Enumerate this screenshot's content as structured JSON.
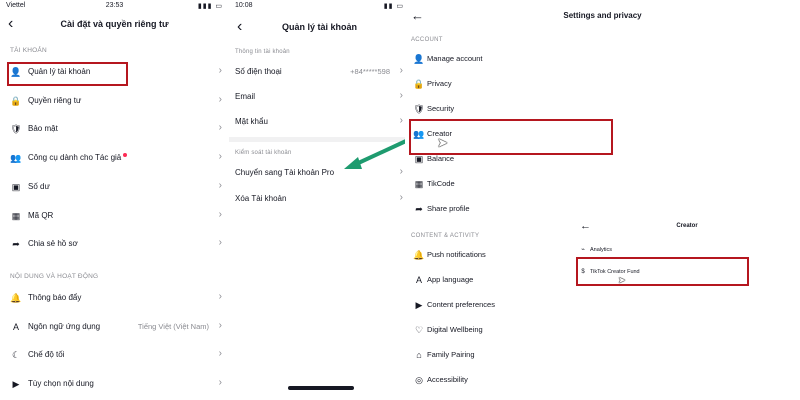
{
  "panel1": {
    "status": {
      "carrier": "Viettel",
      "time": "23:53"
    },
    "title": "Cài đặt và quyền riêng tư",
    "section_account": "TÀI KHOẢN",
    "account_items": [
      {
        "label": "Quản lý tài khoản",
        "icon": "person-icon",
        "glyph": "👤"
      },
      {
        "label": "Quyền riêng tư",
        "icon": "lock-icon",
        "glyph": "🔒"
      },
      {
        "label": "Bảo mật",
        "icon": "shield-icon",
        "glyph": "🛡"
      },
      {
        "label": "Công cụ dành cho Tác giả",
        "icon": "creator-icon",
        "glyph": "👥",
        "badge": true
      },
      {
        "label": "Số dư",
        "icon": "wallet-icon",
        "glyph": "▣"
      },
      {
        "label": "Mã QR",
        "icon": "qr-icon",
        "glyph": "▦"
      },
      {
        "label": "Chia sẻ hồ sơ",
        "icon": "share-icon",
        "glyph": "➦"
      }
    ],
    "section_content": "NỘI DUNG VÀ HOẠT ĐỘNG",
    "content_items": [
      {
        "label": "Thông báo đẩy",
        "icon": "bell-icon",
        "glyph": "🔔"
      },
      {
        "label": "Ngôn ngữ ứng dụng",
        "icon": "language-icon",
        "glyph": "A",
        "value": "Tiếng Việt (Việt Nam)"
      },
      {
        "label": "Chế độ tối",
        "icon": "moon-icon",
        "glyph": "☾"
      },
      {
        "label": "Tùy chọn nội dung",
        "icon": "video-icon",
        "glyph": "▶"
      }
    ]
  },
  "panel2": {
    "status": {
      "time": "10:08"
    },
    "title": "Quản lý tài khoản",
    "section_info": "Thông tin tài khoản",
    "info_items": [
      {
        "label": "Số điện thoại",
        "value": "+84*****598"
      },
      {
        "label": "Email",
        "value": ""
      },
      {
        "label": "Mật khẩu",
        "value": ""
      }
    ],
    "section_control": "Kiểm soát tài khoản",
    "control_items": [
      {
        "label": "Chuyển sang Tài khoản Pro"
      },
      {
        "label": "Xóa Tài khoản"
      }
    ]
  },
  "panel3": {
    "title": "Settings and privacy",
    "section_account": "ACCOUNT",
    "account_items": [
      {
        "label": "Manage account",
        "icon": "person-icon",
        "glyph": "👤"
      },
      {
        "label": "Privacy",
        "icon": "lock-icon",
        "glyph": "🔒"
      },
      {
        "label": "Security",
        "icon": "shield-icon",
        "glyph": "🛡"
      },
      {
        "label": "Creator",
        "icon": "creator-icon",
        "glyph": "👥"
      },
      {
        "label": "Balance",
        "icon": "wallet-icon",
        "glyph": "▣"
      },
      {
        "label": "TikCode",
        "icon": "qr-icon",
        "glyph": "▦"
      },
      {
        "label": "Share profile",
        "icon": "share-icon",
        "glyph": "➦"
      }
    ],
    "section_content": "CONTENT & ACTIVITY",
    "content_items": [
      {
        "label": "Push notifications",
        "icon": "bell-icon",
        "glyph": "🔔"
      },
      {
        "label": "App language",
        "icon": "language-icon",
        "glyph": "A"
      },
      {
        "label": "Content preferences",
        "icon": "video-icon",
        "glyph": "▶"
      },
      {
        "label": "Digital Wellbeing",
        "icon": "wellbeing-icon",
        "glyph": "♡"
      },
      {
        "label": "Family Pairing",
        "icon": "home-icon",
        "glyph": "⌂"
      },
      {
        "label": "Accessibility",
        "icon": "accessibility-icon",
        "glyph": "◎"
      }
    ]
  },
  "creator_sub": {
    "title": "Creator",
    "items": [
      {
        "label": "Analytics",
        "icon": "chart-icon",
        "glyph": "⌁"
      },
      {
        "label": "TikTok Creator Fund",
        "icon": "fund-icon",
        "glyph": "$"
      }
    ]
  },
  "colors": {
    "highlight_box": "#b5171f",
    "arrow": "#1e9b6f",
    "badge": "#fe2c55"
  }
}
